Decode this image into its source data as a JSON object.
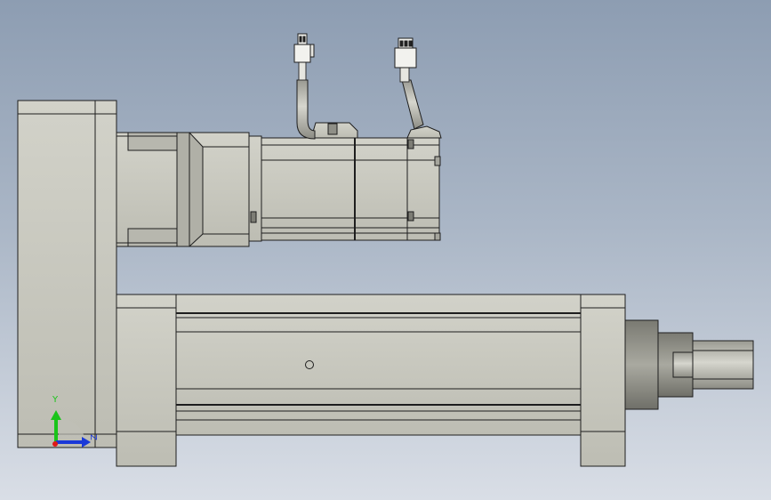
{
  "viewport": {
    "background_top": "#8d9db2",
    "background_bottom": "#d9dee6",
    "model_fill": "#c4c4bb",
    "model_shadow": "#9a9a92",
    "edge_color": "#1e1e1e"
  },
  "triad": {
    "y_label": "Y",
    "z_label": "Z",
    "y_color": "#19c419",
    "z_color": "#1b39d8",
    "x_color": "#e01818"
  }
}
